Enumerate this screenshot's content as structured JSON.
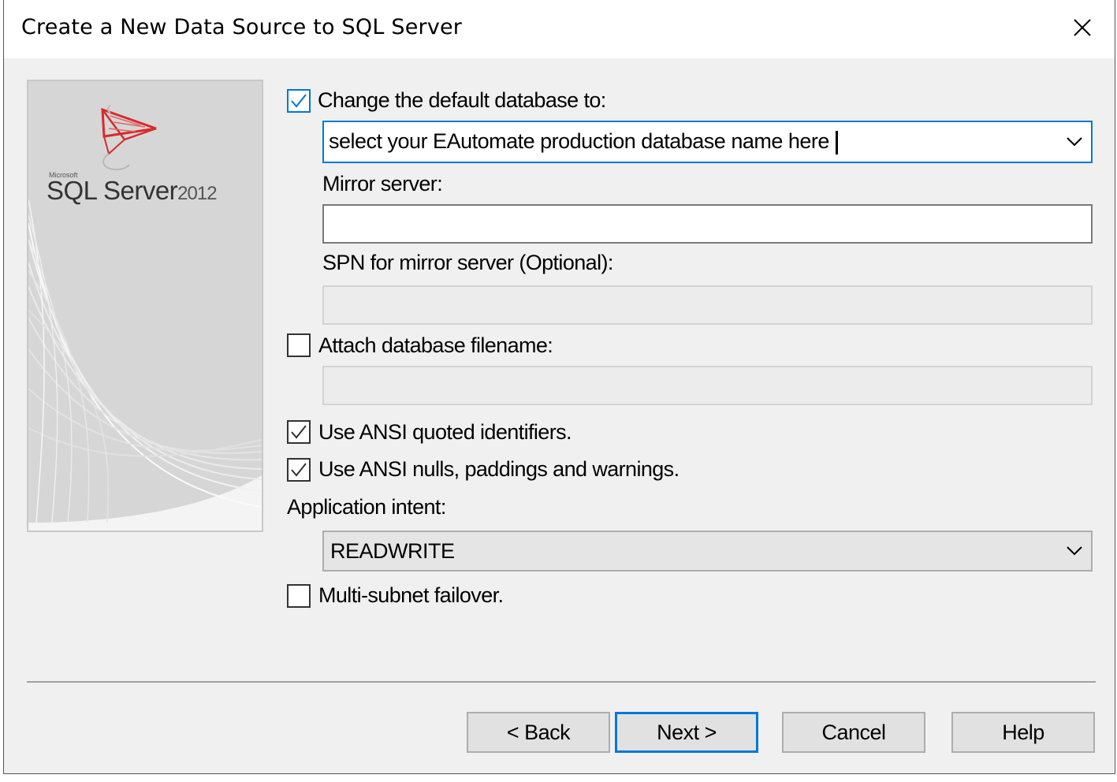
{
  "window": {
    "title": "Create a New Data Source to SQL Server"
  },
  "logo": {
    "vendor": "Microsoft",
    "product": "SQL Server",
    "version": "2012"
  },
  "form": {
    "change_default_db": {
      "label": "Change the default database to:",
      "checked": true,
      "value": "select your EAutomate production database name here"
    },
    "mirror_server": {
      "label": "Mirror server:",
      "value": ""
    },
    "spn_mirror": {
      "label": "SPN for mirror server (Optional):",
      "value": ""
    },
    "attach_db": {
      "label": "Attach database filename:",
      "checked": false,
      "value": ""
    },
    "ansi_quoted": {
      "label": "Use ANSI quoted identifiers.",
      "checked": true
    },
    "ansi_nulls": {
      "label": "Use ANSI nulls, paddings and warnings.",
      "checked": true
    },
    "app_intent": {
      "label": "Application intent:",
      "value": "READWRITE"
    },
    "multi_subnet": {
      "label": "Multi-subnet failover.",
      "checked": false
    }
  },
  "buttons": {
    "back": "< Back",
    "next": "Next >",
    "cancel": "Cancel",
    "help": "Help"
  },
  "colors": {
    "accent": "#0078d7",
    "dialog_bg": "#f0f0f0",
    "logo_red": "#d82b2b"
  }
}
